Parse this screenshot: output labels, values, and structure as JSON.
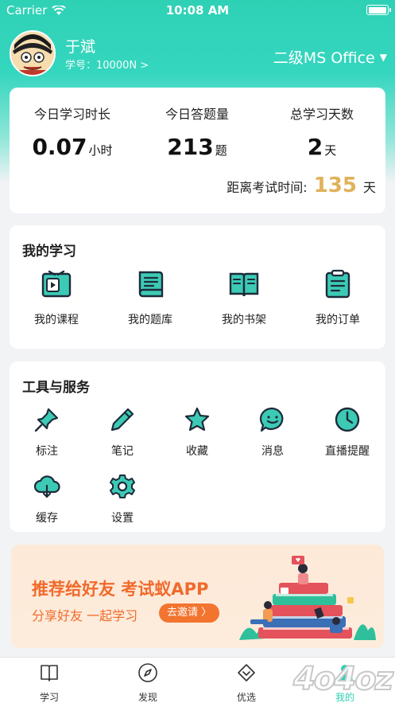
{
  "status_bar": {
    "carrier": "Carrier",
    "time": "10:08 AM",
    "battery_level": 1.0
  },
  "profile": {
    "name": "于斌",
    "student_id": "学号：10000N >",
    "course": "二级MS Office",
    "course_caret": "▼"
  },
  "stats": {
    "study_time": {
      "label": "今日学习时长",
      "value": "0.07",
      "unit": "小时"
    },
    "questions": {
      "label": "今日答题量",
      "value": "213",
      "unit": "题"
    },
    "total_days": {
      "label": "总学习天数",
      "value": "2",
      "unit": "天"
    },
    "countdown": {
      "label": "距离考试时间:",
      "days": "135",
      "unit": "天"
    }
  },
  "my_study": {
    "title": "我的学习",
    "items": [
      {
        "label": "我的课程",
        "icon": "course-icon"
      },
      {
        "label": "我的题库",
        "icon": "question-bank-icon"
      },
      {
        "label": "我的书架",
        "icon": "bookshelf-icon"
      },
      {
        "label": "我的订单",
        "icon": "order-icon"
      }
    ]
  },
  "tools": {
    "title": "工具与服务",
    "items": [
      {
        "label": "标注",
        "icon": "pin-icon"
      },
      {
        "label": "笔记",
        "icon": "pencil-icon"
      },
      {
        "label": "收藏",
        "icon": "star-icon"
      },
      {
        "label": "消息",
        "icon": "message-icon"
      },
      {
        "label": "直播提醒",
        "icon": "clock-icon"
      },
      {
        "label": "缓存",
        "icon": "cloud-download-icon"
      },
      {
        "label": "设置",
        "icon": "gear-icon"
      }
    ]
  },
  "banner": {
    "title": "推荐给好友 考试蚁APP",
    "subtitle": "分享好友  一起学习",
    "invite_label": "去邀请 〉"
  },
  "tabbar": {
    "tabs": [
      {
        "label": "学习",
        "icon": "book-icon"
      },
      {
        "label": "发现",
        "icon": "compass-icon"
      },
      {
        "label": "优选",
        "icon": "diamond-icon"
      },
      {
        "label": "我的",
        "icon": "user-icon"
      }
    ],
    "active": "我的"
  },
  "watermark": "4o4oz",
  "colors": {
    "accent": "#2fcfb3",
    "orange": "#f06a2b",
    "gold": "#e0b25a",
    "icon_teal": "#3ccab5"
  }
}
